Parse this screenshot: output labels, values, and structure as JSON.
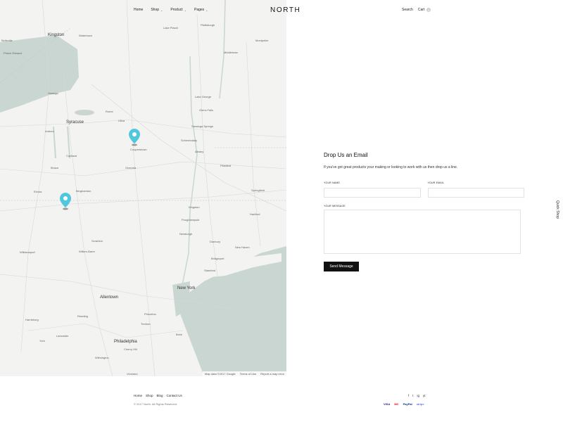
{
  "header": {
    "logo": "NORTH",
    "nav": [
      {
        "label": "Home",
        "has_dropdown": false
      },
      {
        "label": "Shop",
        "has_dropdown": true
      },
      {
        "label": "Product",
        "has_dropdown": true
      },
      {
        "label": "Pages",
        "has_dropdown": true
      }
    ],
    "search_label": "Search",
    "cart_label": "Cart",
    "cart_count": "0"
  },
  "map": {
    "attribution": {
      "data": "Map data ©2017 Google",
      "terms": "Terms of Use",
      "report": "Report a map error"
    },
    "labels": [
      {
        "text": "Kingston",
        "cls": "big"
      },
      {
        "text": "Belleville",
        "cls": ""
      },
      {
        "text": "Prince Edward",
        "cls": ""
      },
      {
        "text": "Watertown",
        "cls": ""
      },
      {
        "text": "Oswego",
        "cls": ""
      },
      {
        "text": "Syracuse",
        "cls": "big"
      },
      {
        "text": "Rome",
        "cls": ""
      },
      {
        "text": "Utica",
        "cls": ""
      },
      {
        "text": "Auburn",
        "cls": ""
      },
      {
        "text": "Cortland",
        "cls": ""
      },
      {
        "text": "Ithaca",
        "cls": ""
      },
      {
        "text": "Elmira",
        "cls": ""
      },
      {
        "text": "Binghamton",
        "cls": ""
      },
      {
        "text": "Oneonta",
        "cls": ""
      },
      {
        "text": "Cooperstown",
        "cls": ""
      },
      {
        "text": "Saratoga Springs",
        "cls": ""
      },
      {
        "text": "Schenectady",
        "cls": ""
      },
      {
        "text": "Albany",
        "cls": ""
      },
      {
        "text": "Pittsfield",
        "cls": ""
      },
      {
        "text": "Springfield",
        "cls": ""
      },
      {
        "text": "Hartford",
        "cls": ""
      },
      {
        "text": "Kingston",
        "cls": ""
      },
      {
        "text": "Poughkeepsie",
        "cls": ""
      },
      {
        "text": "Newburgh",
        "cls": ""
      },
      {
        "text": "Danbury",
        "cls": ""
      },
      {
        "text": "New Haven",
        "cls": ""
      },
      {
        "text": "Bridgeport",
        "cls": ""
      },
      {
        "text": "Stamford",
        "cls": ""
      },
      {
        "text": "Scranton",
        "cls": ""
      },
      {
        "text": "Wilkes-Barre",
        "cls": ""
      },
      {
        "text": "Williamsport",
        "cls": ""
      },
      {
        "text": "Allentown",
        "cls": "big"
      },
      {
        "text": "New York",
        "cls": "big"
      },
      {
        "text": "Trenton",
        "cls": ""
      },
      {
        "text": "Reading",
        "cls": ""
      },
      {
        "text": "Harrisburg",
        "cls": ""
      },
      {
        "text": "Lancaster",
        "cls": ""
      },
      {
        "text": "Philadelphia",
        "cls": "big"
      },
      {
        "text": "Cherry Hill",
        "cls": ""
      },
      {
        "text": "Wilmington",
        "cls": ""
      },
      {
        "text": "Princeton",
        "cls": ""
      },
      {
        "text": "Lake Placid",
        "cls": ""
      },
      {
        "text": "Plattsburgh",
        "cls": ""
      },
      {
        "text": "Montpelier",
        "cls": ""
      },
      {
        "text": "Lake George",
        "cls": ""
      },
      {
        "text": "Glens Falls",
        "cls": ""
      },
      {
        "text": "Middletown",
        "cls": ""
      },
      {
        "text": "Vineland",
        "cls": ""
      },
      {
        "text": "York",
        "cls": ""
      },
      {
        "text": "Brick",
        "cls": ""
      }
    ]
  },
  "contact": {
    "title": "Drop Us an Email",
    "subtitle": "If you've got great products your making or looking to work with us then drop us a line.",
    "name_label": "YOUR NAME",
    "email_label": "YOUR EMAIL",
    "message_label": "YOUR MESSAGE",
    "send_label": "Send Message"
  },
  "quick_shop": "Quick Shop",
  "footer": {
    "links": [
      "Home",
      "Shop",
      "Blog",
      "Contact Us"
    ],
    "copyright": "© 2017 North. All Rights Reserved.",
    "social": [
      "f",
      "t",
      "ig",
      "yt"
    ],
    "payments": [
      "VISA",
      "MC",
      "PayPal",
      "stripe"
    ]
  },
  "colors": {
    "pin": "#4fc7dc",
    "water": "#c6d4d0",
    "button": "#111111"
  }
}
